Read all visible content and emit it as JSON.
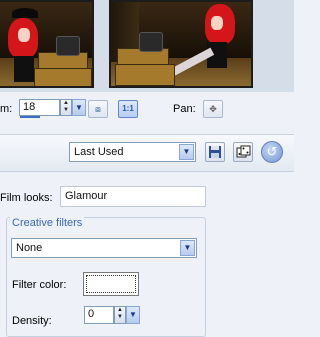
{
  "zoom": {
    "label": "m:",
    "value": "18"
  },
  "pan": {
    "label": "Pan:"
  },
  "preset": {
    "value": "Last Used"
  },
  "film_looks": {
    "label": "Film looks:",
    "value": "Glamour"
  },
  "creative_filters": {
    "title": "Creative filters",
    "value": "None",
    "filter_color_label": "Filter color:",
    "filter_color": "#ffffff",
    "density_label": "Density:",
    "density_value": "0"
  },
  "colors": {
    "accent": "#3d66b4",
    "background": "#eef2f8"
  },
  "icons": {
    "fit": "fit-window-icon",
    "actual": "actual-size-icon",
    "pan": "pan-move-icon",
    "save": "save-disk-icon",
    "dice": "randomize-dice-icon",
    "reset": "reset-icon"
  }
}
